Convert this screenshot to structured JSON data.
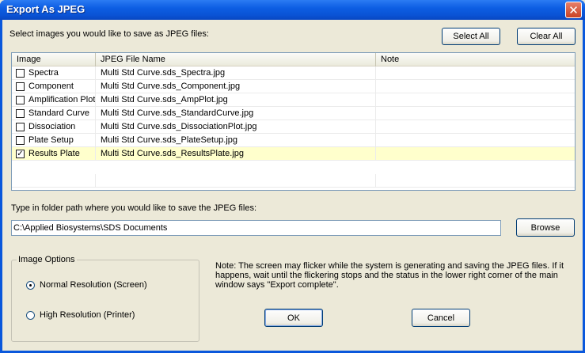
{
  "window": {
    "title": "Export As JPEG",
    "close_glyph": "✕"
  },
  "instructions": "Select images you would like to save as JPEG files:",
  "buttons": {
    "select_all": "Select All",
    "clear_all": "Clear All",
    "browse": "Browse",
    "ok": "OK",
    "cancel": "Cancel"
  },
  "table": {
    "headers": [
      "Image",
      "JPEG File Name",
      "Note"
    ],
    "rows": [
      {
        "image": "Spectra",
        "file": "Multi Std Curve.sds_Spectra.jpg",
        "note": "",
        "checked": false
      },
      {
        "image": "Component",
        "file": "Multi Std Curve.sds_Component.jpg",
        "note": "",
        "checked": false
      },
      {
        "image": "Amplification Plot",
        "file": "Multi Std Curve.sds_AmpPlot.jpg",
        "note": "",
        "checked": false
      },
      {
        "image": "Standard Curve",
        "file": "Multi Std Curve.sds_StandardCurve.jpg",
        "note": "",
        "checked": false
      },
      {
        "image": "Dissociation",
        "file": "Multi Std Curve.sds_DissociationPlot.jpg",
        "note": "",
        "checked": false
      },
      {
        "image": "Plate Setup",
        "file": "Multi Std Curve.sds_PlateSetup.jpg",
        "note": "",
        "checked": false
      },
      {
        "image": "Results Plate",
        "file": "Multi Std Curve.sds_ResultsPlate.jpg",
        "note": "",
        "checked": true
      }
    ],
    "check_glyph": "✓"
  },
  "folder": {
    "label": "Type in folder path where you would like to save the JPEG files:",
    "value": "C:\\Applied Biosystems\\SDS Documents"
  },
  "image_options": {
    "title": "Image Options",
    "normal": "Normal Resolution (Screen)",
    "high": "High Resolution (Printer)",
    "selected": "normal"
  },
  "note": "Note: The screen may flicker while the system is generating and saving the JPEG files. If it happens, wait until the flickering stops and the status in the lower right corner of the main window says \"Export complete\".",
  "colors": {
    "titlebar": "#0a54d6",
    "selected_row": "#ffffcc",
    "dialog_bg": "#ece9d8"
  }
}
